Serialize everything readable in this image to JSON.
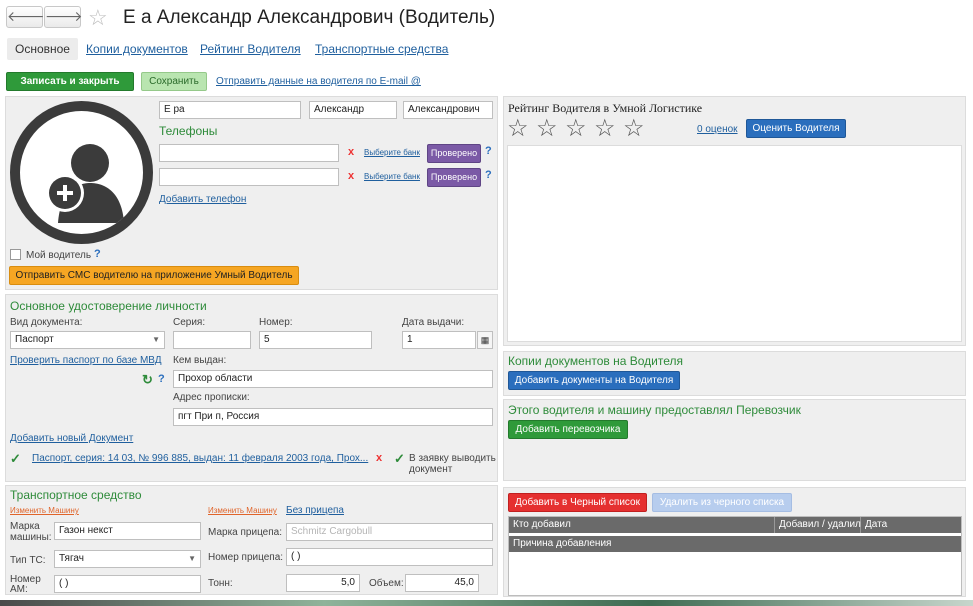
{
  "window": {
    "title": "Е а Александр Александрович (Водитель)"
  },
  "nav": {
    "back": "🡐",
    "forward": "🡒",
    "favorite_star": "☆"
  },
  "tabs": [
    "Основное",
    "Копии документов",
    "Рейтинг Водителя",
    "Транспортные средства"
  ],
  "toolbar": {
    "save_close": "Записать и закрыть",
    "save": "Сохранить",
    "email_link": "Отправить данные на водителя по E-mail @"
  },
  "driver": {
    "last_name": "Е  ра",
    "first_name": "Александр",
    "middle_name": "Александрович",
    "phones_title": "Телефоны",
    "phone_rows": [
      {
        "value": "",
        "bank_link": "Выберите банк",
        "status": "Проверено"
      },
      {
        "value": "",
        "bank_link": "Выберите банк",
        "status": "Проверено"
      }
    ],
    "add_phone": "Добавить телефон",
    "my_driver": "Мой водитель",
    "sms_button": "Отправить СМС водителю на приложение Умный Водитель"
  },
  "identity": {
    "title": "Основное удостоверение личности",
    "doc_type_label": "Вид документа:",
    "doc_type_value": "Паспорт",
    "series_label": "Серия:",
    "series_value": "",
    "number_label": "Номер:",
    "number_value": "  5",
    "issue_date_label": "Дата выдачи:",
    "issue_date_value": "1",
    "check_mvd": "Проверить паспорт по базе МВД",
    "issued_by_label": "Кем выдан:",
    "issued_by_value": "Прохор                              области",
    "address_label": "Адрес прописки:",
    "address_value": "пгт При                                         п, Россия",
    "add_doc": "Добавить новый Документ",
    "doc_line": "Паспорт, серия: 14 03, № 996 885, выдан: 11 февраля 2003 года, Прох...",
    "show_in_request": "В заявку выводить документ"
  },
  "vehicle": {
    "title": "Транспортное средство",
    "change_car": "Изменить Машину",
    "change_trailer": "Изменить Машину",
    "no_trailer": "Без прицепа",
    "car_brand_label": "Марка машины:",
    "car_brand_value": "Газон некст",
    "ts_type_label": "Тип ТС:",
    "ts_type_value": "Тягач",
    "car_number_label": "Номер АМ:",
    "car_number_value": "(      )",
    "trailer_brand_label": "Марка прицепа:",
    "trailer_brand_placeholder": "Schmitz Cargobull",
    "trailer_number_label": "Номер прицепа:",
    "trailer_number_value": "(   )",
    "tons_label": "Тонн:",
    "tons_value": "5,0",
    "volume_label": "Объем:",
    "volume_value": "45,0"
  },
  "rating": {
    "title": "Рейтинг Водителя в Умной Логистике",
    "stars": [
      "☆",
      "☆",
      "☆",
      "☆",
      "☆"
    ],
    "rating_value": 0,
    "reviews_link": "0 оценок",
    "rate_button": "Оценить Водителя"
  },
  "copies": {
    "title": "Копии документов на Водителя",
    "add_button": "Добавить документы на Водителя"
  },
  "carrier": {
    "title": "Этого водителя и машину предоставлял Перевозчик",
    "add_button": "Добавить перевозчика"
  },
  "blacklist": {
    "add_button": "Добавить в Черный список",
    "remove_button": "Удалить из черного списка",
    "columns": [
      "Кто добавил",
      "Добавил / удалил",
      "Дата"
    ],
    "reason_header": "Причина добавления"
  },
  "colors": {
    "accent_green": "#2f9a3a",
    "section_green": "#2e8b3a",
    "link_blue": "#1f5f9e",
    "danger_red": "#e53030",
    "warning_orange": "#f6a623"
  }
}
